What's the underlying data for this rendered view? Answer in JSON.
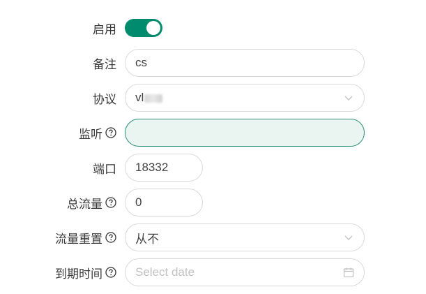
{
  "form": {
    "enable": {
      "label": "启用",
      "on": true
    },
    "remark": {
      "label": "备注",
      "value": "cs"
    },
    "protocol": {
      "label": "协议",
      "value": "vl"
    },
    "listen": {
      "label": "监听",
      "value": ""
    },
    "port": {
      "label": "端口",
      "value": "18332"
    },
    "total_traffic": {
      "label": "总流量",
      "value": "0"
    },
    "traffic_reset": {
      "label": "流量重置",
      "value": "从不"
    },
    "expiry": {
      "label": "到期时间",
      "placeholder": "Select date"
    }
  },
  "colors": {
    "accent": "#008a6e",
    "focus_border": "#2e8f75",
    "focus_bg": "#eaf4f1",
    "border": "#d9d9d9"
  },
  "icons": {
    "help": "question-circle-icon",
    "dropdown": "chevron-down-icon",
    "calendar": "calendar-icon"
  }
}
